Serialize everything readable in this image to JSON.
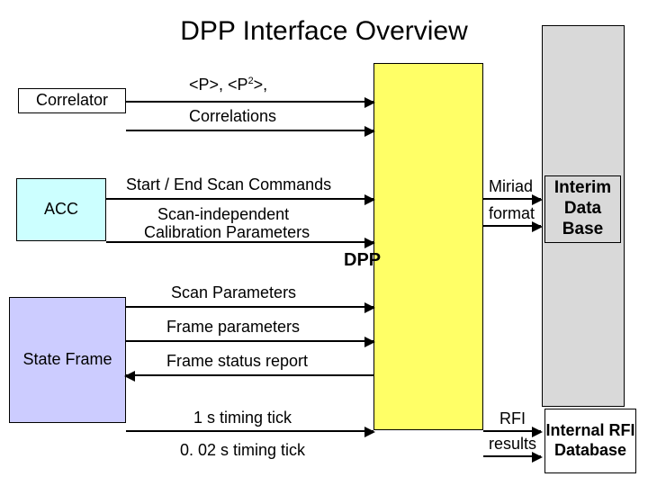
{
  "title": "DPP Interface Overview",
  "nodes": {
    "correlator": "Correlator",
    "acc": "ACC",
    "stateframe": "State Frame",
    "dpp": "DPP",
    "interim": "Interim Data Base",
    "internal": "Internal RFI Database"
  },
  "labels": {
    "p_p2": "<P>, <P2>,",
    "correlations": "Correlations",
    "start_end": "Start / End Scan Commands",
    "scan_indep_l1": "Scan-independent",
    "scan_indep_l2": "Calibration Parameters",
    "scan_params": "Scan Parameters",
    "frame_params": "Frame parameters",
    "frame_status": "Frame status report",
    "tick1": "1 s timing tick",
    "tick002": "0. 02 s timing tick",
    "miriad": "Miriad",
    "format": "format",
    "rfi": "RFI",
    "results": "results"
  }
}
